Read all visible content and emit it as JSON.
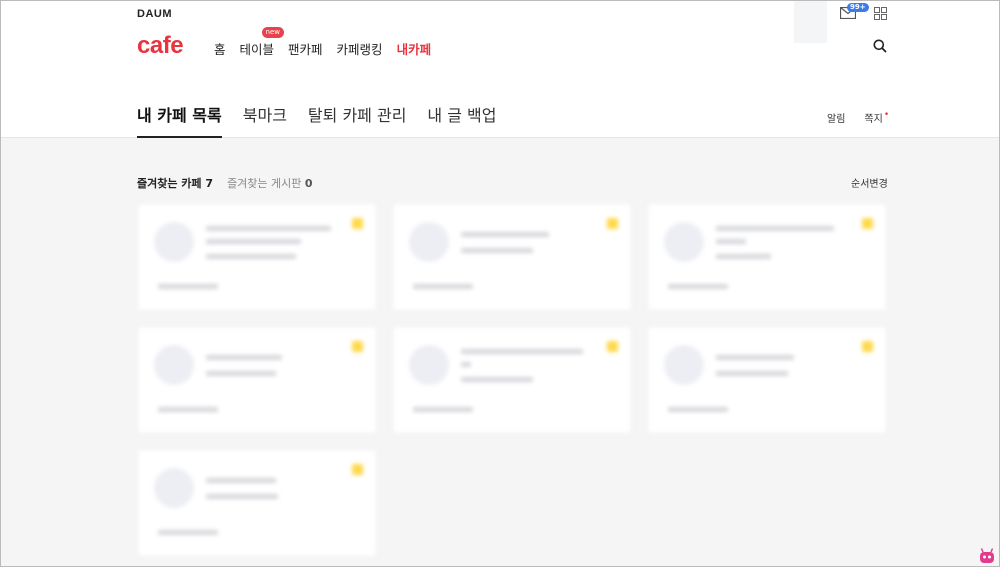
{
  "brand": {
    "daum": "DAUM",
    "cafe": "cafe"
  },
  "gnb": [
    {
      "label": "홈"
    },
    {
      "label": "테이블",
      "badge": "new"
    },
    {
      "label": "팬카페"
    },
    {
      "label": "카페랭킹"
    },
    {
      "label": "내카페",
      "active": true
    }
  ],
  "header": {
    "mail_badge": "99+"
  },
  "tabs": [
    {
      "label": "내 카페 목록",
      "active": true
    },
    {
      "label": "북마크"
    },
    {
      "label": "탈퇴 카페 관리"
    },
    {
      "label": "내 글 백업"
    }
  ],
  "right_links": {
    "noti": "알림",
    "note": "쪽지",
    "note_dot": "•"
  },
  "favorites": {
    "cafe_label": "즐겨찾는 카페",
    "cafe_count": "7",
    "board_label": "즐겨찾는 게시판",
    "board_count": "0",
    "order_change": "순서변경"
  },
  "colors": {
    "accent": "#e8343f",
    "star": "#ffd84a",
    "mail_badge": "#3d7be8"
  }
}
